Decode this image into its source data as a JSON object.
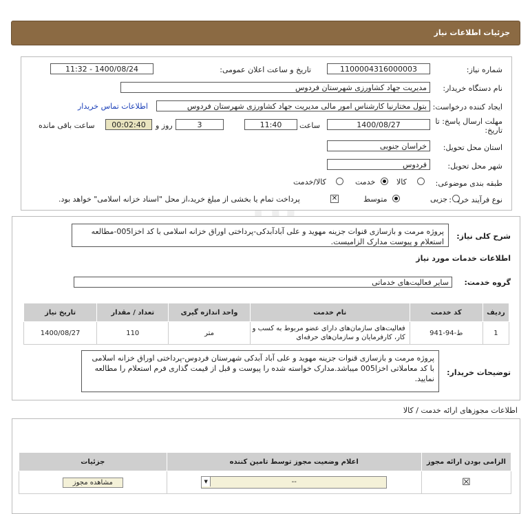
{
  "header": {
    "title": "جزئیات اطلاعات نیاز"
  },
  "need": {
    "number_label": "شماره نیاز:",
    "number_value": "1100004316000003",
    "announce_label": "تاریخ و ساعت اعلان عمومی:",
    "announce_value": "1400/08/24 - 11:32",
    "buyer_label": "نام دستگاه خریدار:",
    "buyer_value": "مدیریت جهاد کشاورزی شهرستان فردوس",
    "creator_label": "ایجاد کننده درخواست:",
    "creator_value": "بتول  مختارنیا کارشناس امور مالی مدیریت جهاد کشاورزی شهرستان فردوس",
    "contact_link": "اطلاعات تماس خریدار",
    "deadline_label_1": "مهلت ارسال پاسخ: تا",
    "deadline_label_2": "تاریخ:",
    "deadline_date": "1400/08/27",
    "time_label": "ساعت",
    "deadline_time": "11:40",
    "days_value": "3",
    "days_label": "روز و",
    "remaining_value": "00:02:40",
    "remaining_label": "ساعت باقی مانده",
    "province_label": "استان محل تحویل:",
    "province_value": "خراسان جنوبی",
    "city_label": "شهر محل تحویل:",
    "city_value": "فردوس",
    "category_label": "طبقه بندی موضوعی:",
    "category_options": [
      "کالا",
      "خدمت",
      "کالا/خدمت"
    ],
    "process_label": "نوع فرآیند خرید :",
    "process_options": [
      "جزیی",
      "متوسط"
    ],
    "payment_note": "پرداخت تمام یا بخشی از مبلغ خرید،از محل \"اسناد خزانه اسلامی\" خواهد بود."
  },
  "summary": {
    "label": "شرح کلی نیاز:",
    "text": "پروژه مرمت و بازسازی قنوات جزینه مهوید و علی آبادآبدکی-پرداختی اوراق خزانه اسلامی با کد اخزا005-مطالعه استعلام و پیوست مدارک الزامیست."
  },
  "services": {
    "section_title": "اطلاعات خدمات مورد نیاز",
    "group_label": "گروه خدمت:",
    "group_value": "سایر فعالیت‌های خدماتی",
    "columns": [
      "ردیف",
      "کد خدمت",
      "نام خدمت",
      "واحد اندازه گیری",
      "تعداد / مقدار",
      "تاریخ نیاز"
    ],
    "rows": [
      {
        "index": "1",
        "code": "ط-94-941",
        "name": "فعالیت‌های سازمان‌های دارای عضو مربوط به کسب و کار، کارفرمایان و سازمان‌های حرفه‌ای",
        "unit": "متر",
        "qty": "110",
        "date": "1400/08/27"
      }
    ]
  },
  "buyer_notes": {
    "label": "توضیحات خریدار:",
    "text": "پروژه مرمت و بازسازی قنوات جزینه مهوید و علی آباد آبدکی شهرستان فردوس-پرداختی اوراق خزانه اسلامی با کد معاملاتی اخزا005 میباشد.مدارک خواسته شده را پیوست و قبل از قیمت گذاری فرم استعلام را مطالعه نمایید."
  },
  "permits": {
    "section_title": "اطلاعات مجوزهای ارائه خدمت / کالا",
    "columns": [
      "الزامی بودن ارائه مجوز",
      "اعلام وضعیت مجوز توسط تامین کننده",
      "جزئیات"
    ],
    "row": {
      "required_mark": "☒",
      "status_value": "--",
      "details_button": "مشاهده مجوز"
    }
  },
  "watermark": {
    "brand": "ParsNamadData",
    "line1": "مرکز فرآیند اطلاعات پارس نماد داده",
    "line2": "اطلاع رسانی مناقصه و مزایده"
  }
}
